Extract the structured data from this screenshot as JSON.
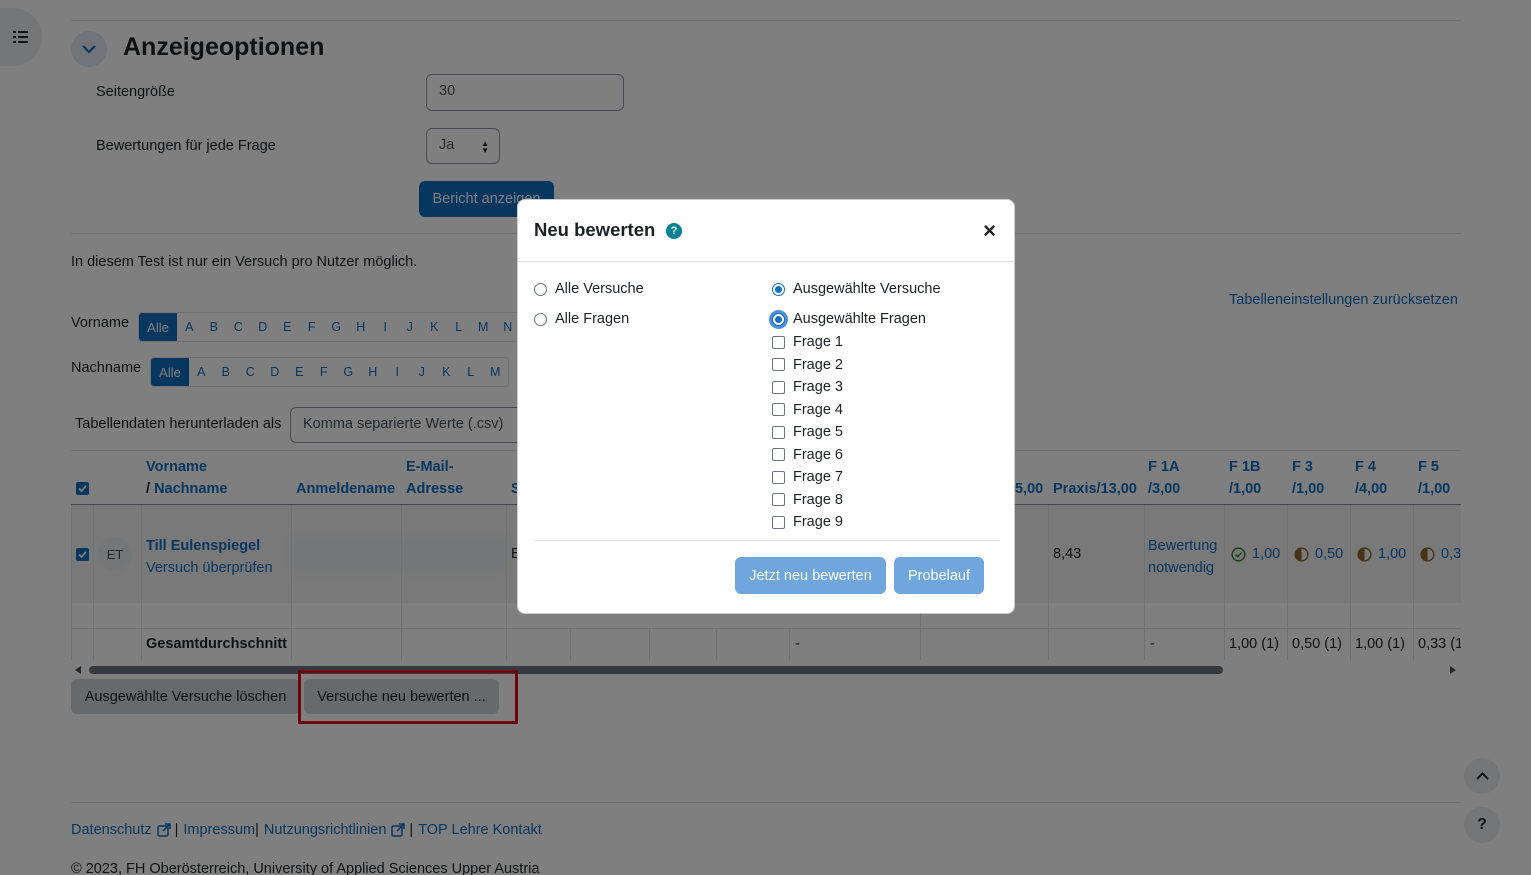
{
  "section": {
    "title": "Anzeigeoptionen"
  },
  "form": {
    "pagesize_label": "Seitengröße",
    "pagesize_value": "30",
    "grades_label": "Bewertungen für jede Frage",
    "grades_value": "Ja",
    "show_report_button": "Bericht anzeigen"
  },
  "info_text": "In diesem Test ist nur ein Versuch pro Nutzer möglich.",
  "reset_table_link": "Tabelleneinstellungen zurücksetzen",
  "initials": {
    "firstname_label": "Vorname",
    "lastname_label": "Nachname",
    "all": "Alle",
    "letters_first": [
      "A",
      "B",
      "C",
      "D",
      "E",
      "F",
      "G",
      "H",
      "I",
      "J",
      "K",
      "L",
      "M",
      "N"
    ],
    "letters_last": [
      "A",
      "B",
      "C",
      "D",
      "E",
      "F",
      "G",
      "H",
      "I",
      "J",
      "K",
      "L",
      "M"
    ]
  },
  "download": {
    "label": "Tabellendaten herunterladen als",
    "value": "Komma separierte Werte (.csv)"
  },
  "table": {
    "headers": {
      "firstname": "Vorname",
      "slash": "/",
      "lastname": "Nachname",
      "username": "Anmeldename",
      "email_line1": "E-Mail-",
      "email_line2": "Adresse",
      "col_partial": "S",
      "col_total_partial": "5,00",
      "praxis": "Praxis/13,00",
      "f1a_l1": "F 1A",
      "f1a_l2": "/3,00",
      "f1b_l1": "F 1B",
      "f1b_l2": "/1,00",
      "f3_l1": "F 3",
      "f3_l2": "/1,00",
      "f4_l1": "F 4",
      "f4_l2": "/4,00",
      "f5_l1": "F 5",
      "f5_l2": "/1,00"
    },
    "row": {
      "initials": "ET",
      "name": "Till Eulenspiegel",
      "review_link": "Versuch überprüfen",
      "partial_text": "E",
      "praxis": "8,43",
      "f1a_l1": "Bewertung",
      "f1a_l2": "notwendig",
      "f1b": "1,00",
      "f3": "0,50",
      "f4": "1,00",
      "f5": "0,3"
    },
    "average": {
      "label": "Gesamtdurchschnitt",
      "dash1": "-",
      "dash2": "-",
      "f1b": "1,00 (1)",
      "f3": "0,50 (1)",
      "f4": "1,00 (1)",
      "f5": "0,33 (1"
    },
    "colors": {
      "correct": "#357a32",
      "partial": "#f0ad4e"
    }
  },
  "bulk_actions": {
    "delete": "Ausgewählte Versuche löschen",
    "regrade": "Versuche neu bewerten ..."
  },
  "footer": {
    "privacy": "Datenschutz",
    "imprint": "Impressum",
    "terms": "Nutzungsrichtlinien",
    "contact": "TOP Lehre Kontakt",
    "sep": "|",
    "copyright": "© 2023, FH Oberösterreich, University of Applied Sciences Upper Austria"
  },
  "modal": {
    "title": "Neu bewerten",
    "help_icon": "?",
    "close": "×",
    "all_attempts": "Alle Versuche",
    "selected_attempts": "Ausgewählte Versuche",
    "all_questions": "Alle Fragen",
    "selected_questions": "Ausgewählte Fragen",
    "questions": [
      "Frage 1",
      "Frage 2",
      "Frage 3",
      "Frage 4",
      "Frage 5",
      "Frage 6",
      "Frage 7",
      "Frage 8",
      "Frage 9"
    ],
    "regrade_now": "Jetzt neu bewerten",
    "dry_run": "Probelauf"
  }
}
